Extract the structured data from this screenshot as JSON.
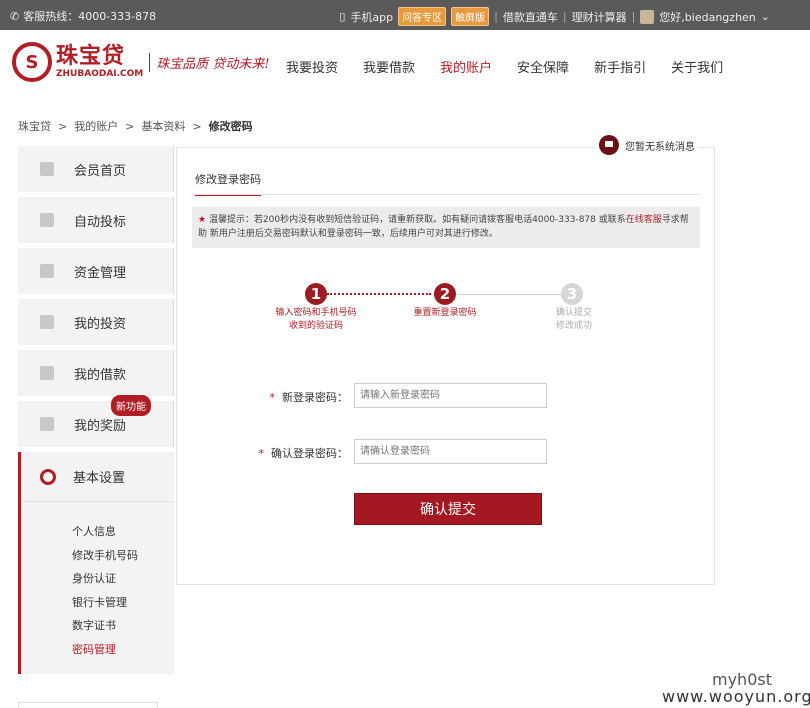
{
  "topbar": {
    "hotline": "客服热线：4000-333-878",
    "app": "手机app",
    "qa": "问答专区",
    "touch": "触屏版",
    "loan_express": "借款直通车",
    "calculator": "理财计算器",
    "greeting": "您好,biedangzhen"
  },
  "header": {
    "logo_cn": "珠宝贷",
    "logo_en": "ZHUBAODAI.COM",
    "slogan": "珠宝品质 贷动未来!",
    "nav": [
      "我要投资",
      "我要借款",
      "我的账户",
      "安全保障",
      "新手指引",
      "关于我们"
    ],
    "active_nav": "我的账户"
  },
  "breadcrumb": {
    "items": [
      "珠宝贷",
      "我的账户",
      "基本资料"
    ],
    "current": "修改密码",
    "separator": ">"
  },
  "sidebar": {
    "items": [
      "会员首页",
      "自动投标",
      "资金管理",
      "我的投资",
      "我的借款",
      "我的奖励"
    ],
    "new_badge": "新功能",
    "settings_title": "基本设置",
    "sub_items": [
      "个人信息",
      "修改手机号码",
      "身份认证",
      "银行卡管理",
      "数字证书",
      "密码管理"
    ],
    "current_sub": "密码管理"
  },
  "main": {
    "message": "您暂无系统消息",
    "tab": "修改登录密码",
    "tip_star": "★",
    "tip_line1": "温馨提示：若200秒内没有收到短信验证码，请重新获取。如有疑问请拨客服电话4000-333-878 或联系",
    "tip_link": "在线客服",
    "tip_line1_end": "寻求帮",
    "tip_line2": "助    新用户注册后交易密码默认和登录密码一致，后续用户可对其进行修改。",
    "steps": [
      {
        "num": "1",
        "label_1": "输入密码和手机号码",
        "label_2": "收到的验证码"
      },
      {
        "num": "2",
        "label_1": "重置新登录密码",
        "label_2": ""
      },
      {
        "num": "3",
        "label_1": "确认提交",
        "label_2": "修改成功"
      }
    ],
    "form": {
      "new_label": "新登录密码：",
      "new_placeholder": "请输入新登录密码",
      "confirm_label": "确认登录密码：",
      "confirm_placeholder": "请确认登录密码",
      "required_mark": "*"
    },
    "submit": "确认提交"
  },
  "watermark": {
    "line1": "myh0st",
    "line2": "www.wooyun.org"
  }
}
